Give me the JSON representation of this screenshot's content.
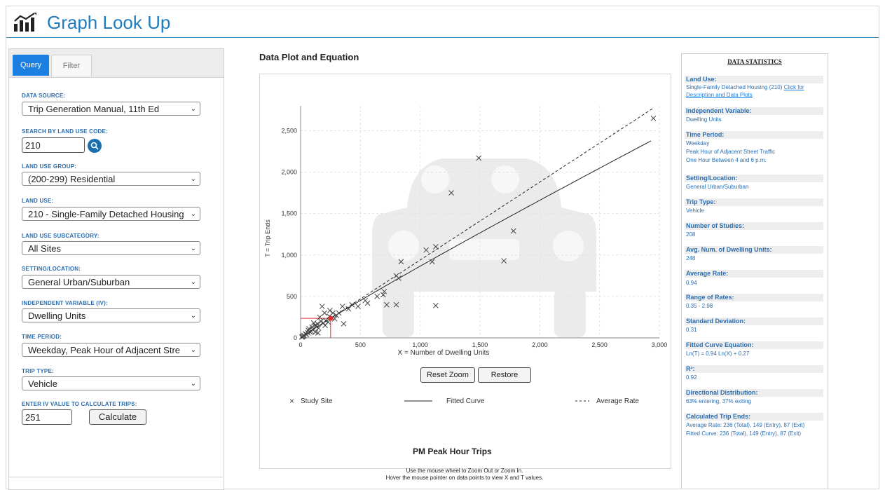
{
  "header": {
    "title": "Graph Look Up",
    "logo_icon": "bar-chart-trend-icon"
  },
  "tabs": {
    "query": "Query",
    "filter": "Filter"
  },
  "form": {
    "data_source_label": "DATA SOURCE:",
    "data_source_value": "Trip Generation Manual, 11th Ed",
    "search_label": "SEARCH BY LAND USE CODE:",
    "search_value": "210",
    "land_use_group_label": "LAND USE GROUP:",
    "land_use_group_value": "(200-299) Residential",
    "land_use_label": "LAND USE:",
    "land_use_value": "210 - Single-Family Detached Housing",
    "subcategory_label": "LAND USE SUBCATEGORY:",
    "subcategory_value": "All Sites",
    "setting_label": "SETTING/LOCATION:",
    "setting_value": "General Urban/Suburban",
    "iv_label": "INDEPENDENT VARIABLE (IV):",
    "iv_value": "Dwelling Units",
    "time_label": "TIME PERIOD:",
    "time_value": "Weekday, Peak Hour of Adjacent Stre",
    "trip_label": "TRIP TYPE:",
    "trip_value": "Vehicle",
    "calc_label": "ENTER IV VALUE TO CALCULATE TRIPS:",
    "calc_value": "251",
    "calc_button": "Calculate"
  },
  "middle": {
    "title": "Data Plot and Equation",
    "reset_zoom": "Reset Zoom",
    "restore": "Restore",
    "legend_study": "Study Site",
    "legend_fitted": "Fitted Curve",
    "legend_average": "Average Rate",
    "plot_title": "PM Peak Hour Trips",
    "note_line1": "Use the mouse wheel to Zoom Out or Zoom In.",
    "note_line2": "Hover the mouse pointer on data points to view X and T values."
  },
  "chart_data": {
    "type": "scatter",
    "xlabel": "X = Number of Dwelling Units",
    "ylabel": "T = Trip Ends",
    "xlim": [
      0,
      3000
    ],
    "ylim": [
      0,
      2800
    ],
    "xticks": [
      "0",
      "500",
      "1,000",
      "1,500",
      "2,000",
      "2,500",
      "3,000"
    ],
    "yticks": [
      "0",
      "500",
      "1,000",
      "1,500",
      "2,000",
      "2,500"
    ],
    "grid": true,
    "legend_placement": "bottom",
    "marker_color": "#444444",
    "highlight_color": "#e03030",
    "highlight_point": [
      251,
      236
    ],
    "study_sites": [
      [
        2950,
        2650
      ],
      [
        1490,
        2170
      ],
      [
        1260,
        1750
      ],
      [
        1780,
        1290
      ],
      [
        1700,
        930
      ],
      [
        1130,
        1100
      ],
      [
        1050,
        1060
      ],
      [
        1100,
        920
      ],
      [
        840,
        920
      ],
      [
        800,
        750
      ],
      [
        820,
        720
      ],
      [
        720,
        400
      ],
      [
        800,
        400
      ],
      [
        1130,
        390
      ],
      [
        700,
        560
      ],
      [
        690,
        520
      ],
      [
        640,
        500
      ],
      [
        560,
        420
      ],
      [
        540,
        450
      ],
      [
        480,
        380
      ],
      [
        430,
        400
      ],
      [
        400,
        350
      ],
      [
        360,
        170
      ],
      [
        320,
        300
      ],
      [
        300,
        270
      ],
      [
        260,
        240
      ],
      [
        240,
        260
      ],
      [
        210,
        210
      ],
      [
        200,
        300
      ],
      [
        190,
        180
      ],
      [
        170,
        200
      ],
      [
        150,
        120
      ],
      [
        140,
        170
      ],
      [
        130,
        140
      ],
      [
        120,
        150
      ],
      [
        100,
        100
      ],
      [
        90,
        80
      ],
      [
        80,
        70
      ],
      [
        70,
        110
      ],
      [
        60,
        60
      ],
      [
        50,
        40
      ],
      [
        40,
        50
      ],
      [
        30,
        30
      ],
      [
        25,
        20
      ],
      [
        20,
        25
      ],
      [
        15,
        15
      ],
      [
        10,
        10
      ],
      [
        180,
        380
      ],
      [
        270,
        300
      ],
      [
        350,
        380
      ],
      [
        110,
        180
      ],
      [
        160,
        250
      ],
      [
        230,
        190
      ],
      [
        285,
        230
      ],
      [
        145,
        60
      ],
      [
        95,
        130
      ],
      [
        65,
        90
      ],
      [
        125,
        70
      ],
      [
        205,
        150
      ],
      [
        245,
        330
      ]
    ],
    "fitted_curve": "Ln(T) = 0.94 Ln(X) + 0.27",
    "average_rate": 0.94
  },
  "stats": {
    "title": "DATA STATISTICS",
    "land_use_h": "Land Use:",
    "land_use_v": "Single-Family Detached Housing (210)",
    "land_use_link": "Click for Description and Data Plots",
    "iv_h": "Independent Variable:",
    "iv_v": "Dwelling Units",
    "time_h": "Time Period:",
    "time_v1": "Weekday",
    "time_v2": "Peak Hour of Adjacent Street Traffic",
    "time_v3": "One Hour Between 4 and 6 p.m.",
    "setting_h": "Setting/Location:",
    "setting_v": "General Urban/Suburban",
    "trip_h": "Trip Type:",
    "trip_v": "Vehicle",
    "studies_h": "Number of Studies:",
    "studies_v": "208",
    "avg_units_h": "Avg. Num. of Dwelling Units:",
    "avg_units_v": "248",
    "avg_rate_h": "Average Rate:",
    "avg_rate_v": "0.94",
    "range_h": "Range of Rates:",
    "range_v": "0.35 - 2.98",
    "stddev_h": "Standard Deviation:",
    "stddev_v": "0.31",
    "fitted_h": "Fitted Curve Equation:",
    "fitted_v": "Ln(T) = 0.94 Ln(X) + 0.27",
    "r2_h": "R²:",
    "r2_v": "0.92",
    "dir_h": "Directional Distribution:",
    "dir_v": "63% entering, 37% exiting",
    "calc_h": "Calculated Trip Ends:",
    "calc_v1": "Average Rate: 236 (Total), 149 (Entry), 87 (Exit)",
    "calc_v2": "Fitted Curve: 236 (Total), 149 (Entry), 87 (Exit)"
  }
}
